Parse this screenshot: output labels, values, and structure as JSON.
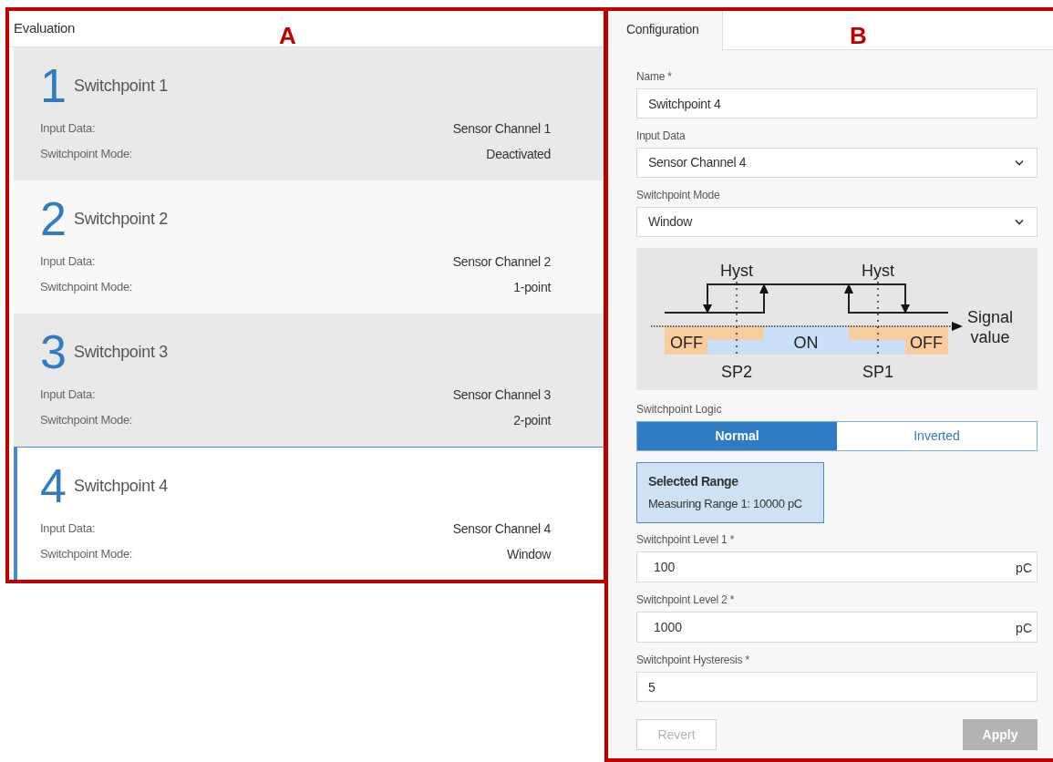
{
  "annotations": [
    {
      "label": "A"
    },
    {
      "label": "B"
    }
  ],
  "evaluation": {
    "title": "Evaluation",
    "switchpoints": [
      {
        "number": "1",
        "name": "Switchpoint 1",
        "selected": false,
        "rows": [
          {
            "label": "Input Data:",
            "value": "Sensor Channel 1"
          },
          {
            "label": "Switchpoint Mode:",
            "value": "Deactivated"
          }
        ]
      },
      {
        "number": "2",
        "name": "Switchpoint 2",
        "selected": false,
        "rows": [
          {
            "label": "Input Data:",
            "value": "Sensor Channel 2"
          },
          {
            "label": "Switchpoint Mode:",
            "value": "1-point"
          }
        ]
      },
      {
        "number": "3",
        "name": "Switchpoint 3",
        "selected": false,
        "rows": [
          {
            "label": "Input Data:",
            "value": "Sensor Channel 3"
          },
          {
            "label": "Switchpoint Mode:",
            "value": "2-point"
          }
        ]
      },
      {
        "number": "4",
        "name": "Switchpoint 4",
        "selected": true,
        "rows": [
          {
            "label": "Input Data:",
            "value": "Sensor Channel 4"
          },
          {
            "label": "Switchpoint Mode:",
            "value": "Window"
          }
        ]
      }
    ]
  },
  "configuration": {
    "tabs": [
      {
        "label": "Configuration",
        "selected": true
      }
    ],
    "fields": [
      {
        "kind": "text",
        "label": "Name *",
        "value": "Switchpoint 4"
      },
      {
        "kind": "select",
        "label": "Input Data",
        "value": "Sensor Channel 4"
      },
      {
        "kind": "select",
        "label": "Switchpoint Mode",
        "value": "Window"
      }
    ],
    "diagram": {
      "hyst_left": "Hyst",
      "hyst_right": "Hyst",
      "axis_label_lines": [
        "Signal",
        "value"
      ],
      "off_left": "OFF",
      "on": "ON",
      "off_right": "OFF",
      "sp2": "SP2",
      "sp1": "SP1"
    },
    "logic": {
      "label": "Switchpoint Logic",
      "options": [
        {
          "label": "Normal",
          "selected": true
        },
        {
          "label": "Inverted",
          "selected": false
        }
      ]
    },
    "selected_range": {
      "title": "Selected Range",
      "text": "Measuring Range 1: 10000 pC"
    },
    "levels": [
      {
        "kind": "unit",
        "label": "Switchpoint Level 1 *",
        "value": "100",
        "unit": "pC"
      },
      {
        "kind": "unit",
        "label": "Switchpoint Level 2 *",
        "value": "1000",
        "unit": "pC"
      },
      {
        "kind": "text",
        "label": "Switchpoint Hysteresis *",
        "value": "5"
      }
    ],
    "buttons": [
      {
        "kind": "secondary",
        "label": "Revert",
        "disabled": true
      },
      {
        "kind": "primary",
        "label": "Apply",
        "disabled": true
      }
    ]
  }
}
